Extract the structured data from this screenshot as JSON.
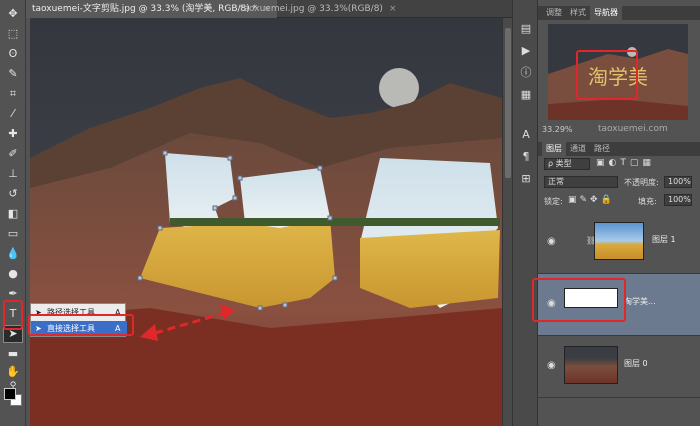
{
  "tabs": [
    {
      "label": "taoxuemei-文字剪贴.jpg @ 33.3% (淘学美, RGB/8) *",
      "close": "×"
    },
    {
      "label": "taoxuemei.jpg @ 33.3%(RGB/8)",
      "close": "×"
    }
  ],
  "panel_tabs": [
    "调整",
    "样式",
    "导航器"
  ],
  "navigator": {
    "zoom": "33.29%",
    "watermark": "taoxuemei.com"
  },
  "layers_tabs": [
    "图层",
    "通道",
    "路径"
  ],
  "layers": {
    "filter_type": "ρ 类型",
    "blend_mode": "正常",
    "opacity_label": "不透明度:",
    "opacity_value": "100%",
    "lock_label": "锁定:",
    "fill_label": "填充:",
    "fill_value": "100%",
    "items": [
      {
        "name": "图层 1"
      },
      {
        "name": "淘学美..."
      },
      {
        "name": "图层 0"
      }
    ]
  },
  "popup": {
    "items": [
      {
        "label": "路径选择工具",
        "shortcut": "A"
      },
      {
        "label": "直接选择工具",
        "shortcut": "A"
      }
    ]
  },
  "canvas_text": "淘学美",
  "colors": {
    "highlight": "#e0282a",
    "selected_layer": "#6b7a8f"
  }
}
